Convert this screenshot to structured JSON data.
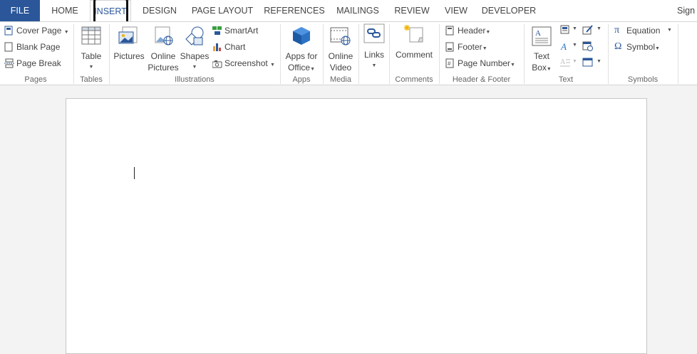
{
  "tabs": {
    "file": "FILE",
    "home": "HOME",
    "insert": "INSERT",
    "design": "DESIGN",
    "page_layout": "PAGE LAYOUT",
    "references": "REFERENCES",
    "mailings": "MAILINGS",
    "review": "REVIEW",
    "view": "VIEW",
    "developer": "DEVELOPER",
    "sign": "Sign"
  },
  "groups": {
    "pages": {
      "label": "Pages",
      "cover_page": "Cover Page",
      "blank_page": "Blank Page",
      "page_break": "Page Break"
    },
    "tables": {
      "label": "Tables",
      "table": "Table"
    },
    "illustrations": {
      "label": "Illustrations",
      "pictures": "Pictures",
      "online_pictures_1": "Online",
      "online_pictures_2": "Pictures",
      "shapes": "Shapes",
      "smartart": "SmartArt",
      "chart": "Chart",
      "screenshot": "Screenshot"
    },
    "apps": {
      "label": "Apps",
      "apps_1": "Apps for",
      "apps_2": "Office"
    },
    "media": {
      "label": "Media",
      "online_video_1": "Online",
      "online_video_2": "Video"
    },
    "links": {
      "label": "",
      "links": "Links"
    },
    "comments": {
      "label": "Comments",
      "comment": "Comment"
    },
    "header_footer": {
      "label": "Header & Footer",
      "header": "Header",
      "footer": "Footer",
      "page_number": "Page Number"
    },
    "text": {
      "label": "Text",
      "text_box_1": "Text",
      "text_box_2": "Box"
    },
    "symbols": {
      "label": "Symbols",
      "equation": "Equation",
      "symbol": "Symbol"
    }
  },
  "colors": {
    "file_tab": "#2b579a",
    "accent_blue": "#2b579a",
    "ribbon_bg": "#ffffff",
    "workspace_bg": "#f3f3f3"
  }
}
